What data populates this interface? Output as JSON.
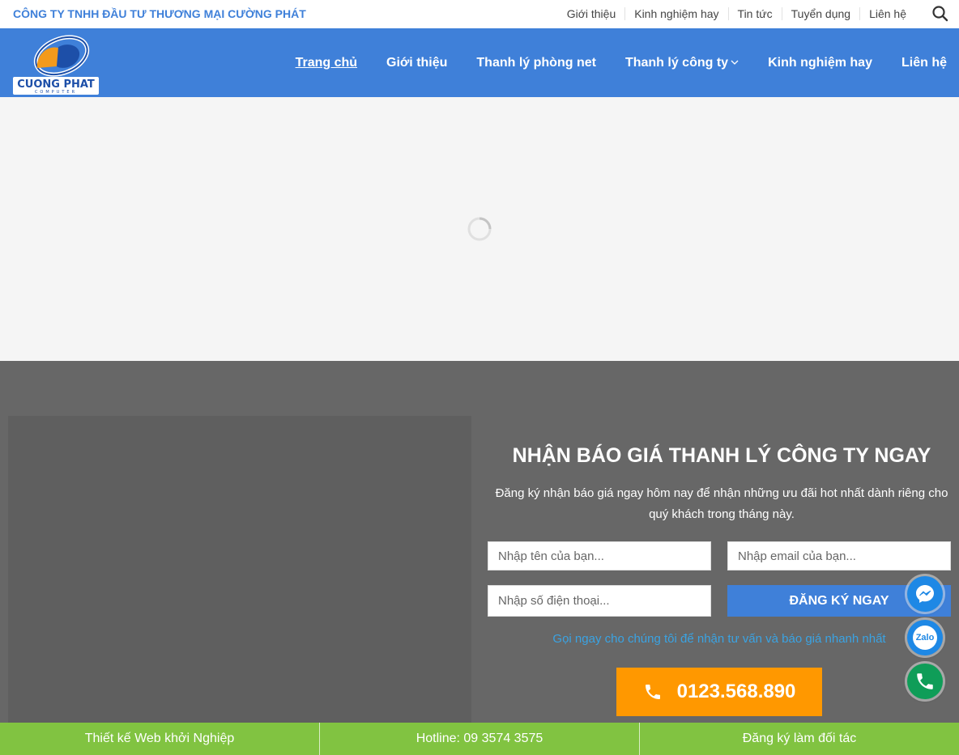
{
  "topbar": {
    "company": "CÔNG TY TNHH ĐẦU TƯ THƯƠNG MẠI CƯỜNG PHÁT",
    "links": [
      "Giới thiệu",
      "Kinh nghiệm hay",
      "Tin tức",
      "Tuyển dụng",
      "Liên hệ"
    ],
    "search_icon": "search-icon"
  },
  "header": {
    "logo_text": "CUONG PHAT",
    "logo_sub": "COMPUTER",
    "nav": [
      "Trang chủ",
      "Giới thiệu",
      "Thanh lý phòng net",
      "Thanh lý công ty",
      "Kinh nghiệm hay",
      "Liên hệ"
    ]
  },
  "form": {
    "title": "NHẬN BÁO GIÁ THANH LÝ CÔNG TY NGAY",
    "description": "Đăng ký nhận báo giá ngay hôm nay để nhận những ưu đãi hot nhất dành riêng cho quý khách trong tháng này.",
    "name_placeholder": "Nhập tên của bạn...",
    "email_placeholder": "Nhập email của bạn...",
    "phone_placeholder": "Nhập số điện thoại...",
    "submit_label": "ĐĂNG KÝ NGAY",
    "call_note": "Gọi ngay cho chúng tôi để nhận tư vấn và báo giá nhanh nhất",
    "phone_number": "0123.568.890"
  },
  "floating": {
    "zalo_label": "Zalo"
  },
  "bottombar": {
    "items": [
      "Thiết kế Web khởi Nghiệp",
      "Hotline: 09 3574 3575",
      "Đăng ký làm đối tác"
    ]
  },
  "colors": {
    "brand_blue": "#3f80d9",
    "orange": "#ff9800",
    "green": "#81c341",
    "dark_section": "#676767"
  }
}
